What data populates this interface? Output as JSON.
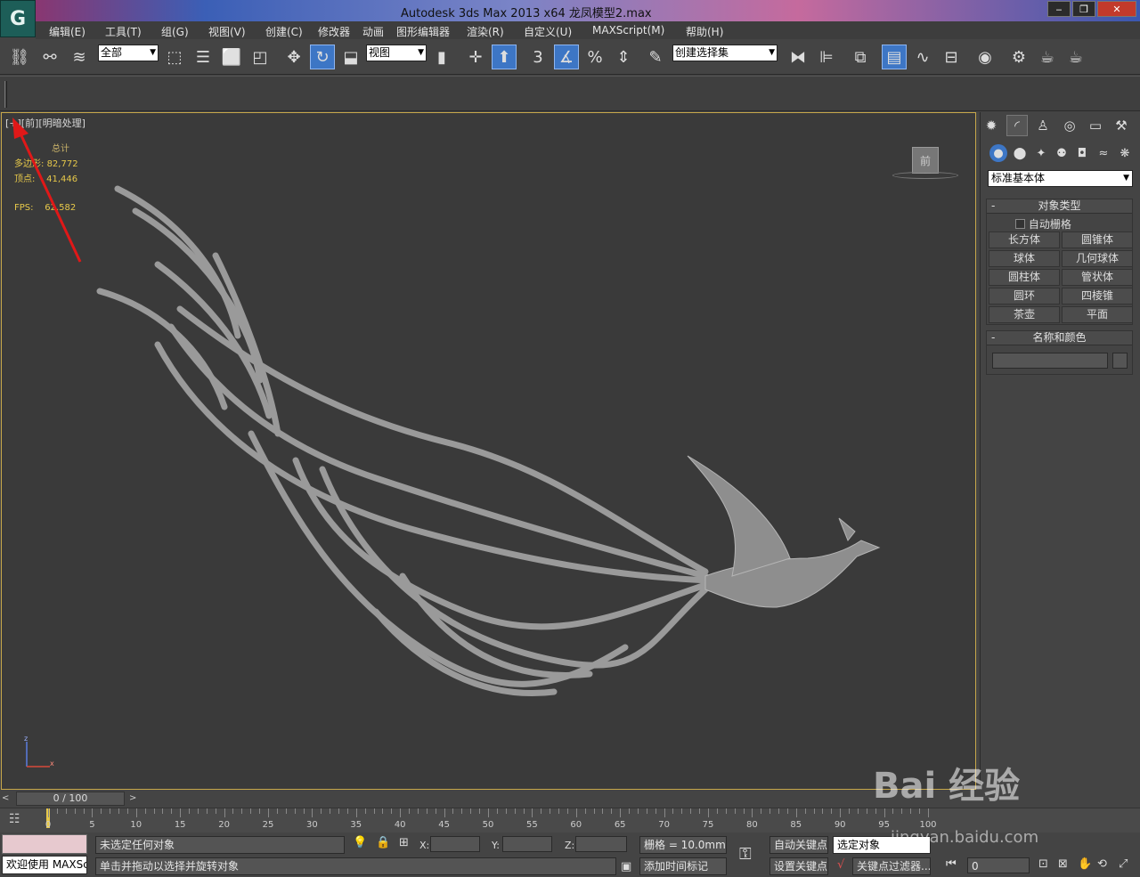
{
  "window": {
    "title": "Autodesk 3ds Max  2013 x64      龙凤模型2.max",
    "app_logo": "G",
    "controls": [
      "‒",
      "❐",
      "✕"
    ]
  },
  "menu": [
    "编辑(E)",
    "工具(T)",
    "组(G)",
    "视图(V)",
    "创建(C)",
    "修改器",
    "动画",
    "图形编辑器",
    "渲染(R)",
    "自定义(U)",
    "MAXScript(M)",
    "帮助(H)"
  ],
  "toolbar": {
    "selection_filter": "全部",
    "ref_coord": "视图",
    "named_selection": "创建选择集",
    "snap_number": "3",
    "angle_symbol": "%"
  },
  "viewport": {
    "label": "[+][前][明暗处理]",
    "stats_header": "总计",
    "polys_label": "多边形:",
    "polys_value": "82,772",
    "verts_label": "顶点:",
    "verts_value": "41,446",
    "fps_label": "FPS:",
    "fps_value": "62.582",
    "viewcube_label": "前",
    "axis_z": "z",
    "axis_x": "x"
  },
  "command_panel": {
    "dropdown": "标准基本体",
    "object_type_header": "对象类型",
    "auto_grid": "自动栅格",
    "buttons": [
      "长方体",
      "圆锥体",
      "球体",
      "几何球体",
      "圆柱体",
      "管状体",
      "圆环",
      "四棱锥",
      "茶壶",
      "平面"
    ],
    "name_color_header": "名称和颜色"
  },
  "timeline": {
    "frame_display": "0 / 100",
    "ticks": [
      "0",
      "5",
      "10",
      "15",
      "20",
      "25",
      "30",
      "35",
      "40",
      "45",
      "50",
      "55",
      "60",
      "65",
      "70",
      "75",
      "80",
      "85",
      "90",
      "95",
      "100"
    ]
  },
  "status": {
    "welcome": "欢迎使用 MAXSci",
    "selection": "未选定任何对象",
    "prompt": "单击并拖动以选择并旋转对象",
    "x_label": "X:",
    "y_label": "Y:",
    "z_label": "Z:",
    "grid": "栅格 = 10.0mm",
    "add_time_tag": "添加时间标记",
    "auto_key": "自动关键点",
    "selected_object": "选定对象",
    "set_key": "设置关键点",
    "key_filters": "关键点过滤器...",
    "frame_input": "0"
  },
  "watermark": {
    "main": "Bai 经验",
    "sub": "jingyan.baidu.com"
  },
  "colors": {
    "annotation_arrow": "#e01818",
    "active_blue": "#3d76c5",
    "stats_yellow": "#e6c84a",
    "viewport_border": "#c7a74a"
  }
}
